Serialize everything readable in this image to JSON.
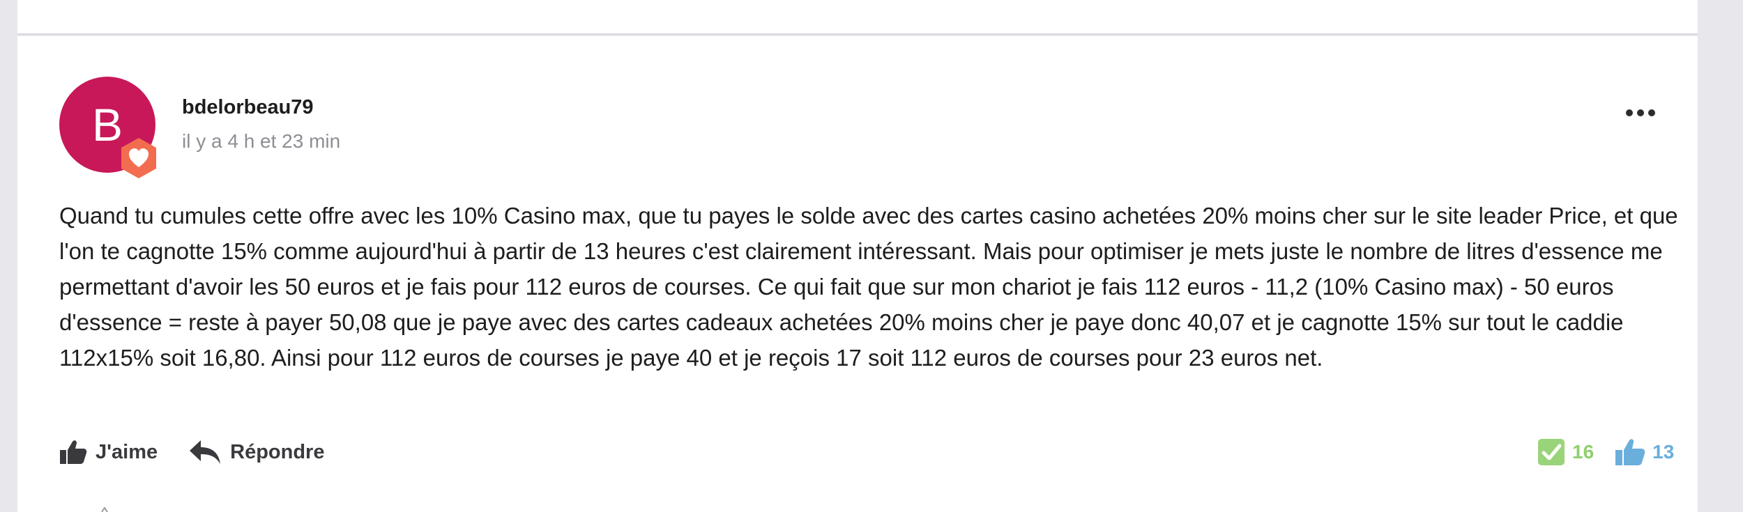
{
  "comment": {
    "author": {
      "initial": "B",
      "username": "bdelorbeau79",
      "avatar_color": "#c8185a",
      "badge_icon": "heart-badge-icon"
    },
    "timestamp": "il y a 4 h et 23 min",
    "body": "Quand tu cumules cette offre avec les 10% Casino max, que tu payes le solde avec des cartes casino achetées 20% moins cher sur le site leader Price, et que l'on te cagnotte 15% comme aujourd'hui à partir de 13 heures c'est clairement intéressant. Mais pour optimiser je mets juste le nombre de litres d'essence me permettant d'avoir les 50 euros et je fais pour 112 euros de courses. Ce qui fait que sur mon chariot je fais 112 euros - 11,2 (10% Casino max) - 50 euros d'essence = reste à payer 50,08 que je paye avec des cartes cadeaux achetées 20% moins cher je paye donc 40,07 et je cagnotte 15% sur tout le caddie 112x15% soit 16,80. Ainsi pour 112 euros de courses je paye 40 et je reçois 17 soit 112 euros de courses pour 23 euros net.",
    "actions": {
      "like_label": "J'aime",
      "like_icon": "thumbs-up-icon",
      "reply_label": "Répondre",
      "reply_icon": "reply-arrow-icon"
    },
    "stats": {
      "approvals": "16",
      "approval_icon": "green-check-icon",
      "approval_color": "#8fcf6f",
      "likes": "13",
      "likes_icon": "blue-thumbs-up-icon",
      "likes_color": "#6aaedc"
    },
    "menu_icon": "more-dots-icon"
  }
}
